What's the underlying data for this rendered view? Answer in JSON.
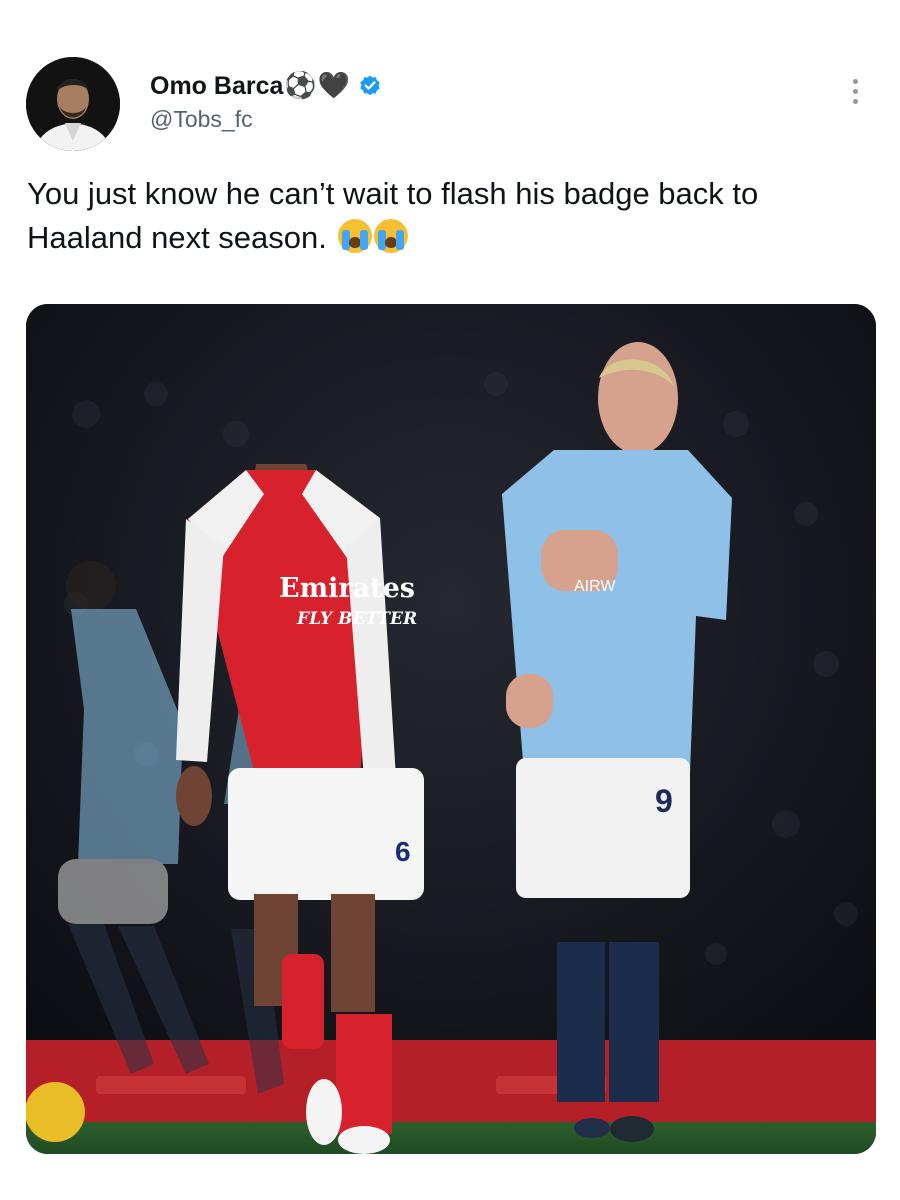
{
  "author": {
    "display_name": "Omo Barca",
    "name_emojis": [
      "⚽",
      "🖤"
    ],
    "verified": true,
    "handle": "@Tobs_fc"
  },
  "tweet": {
    "text": "You just know he can’t wait to flash his badge back to Haaland next season.",
    "trailing_emojis": [
      "😭",
      "😭"
    ]
  },
  "media": {
    "left_shirt": {
      "sponsor": "Emirates",
      "slogan": "FLY BETTER",
      "number": "6"
    },
    "right_shirt": {
      "sponsor_fragment": "AIRW",
      "number": "9"
    }
  },
  "colors": {
    "verified": "#1d9bf0",
    "arsenal_red": "#d7212c",
    "city_blue": "#8fc0e8",
    "text": "#0f1419",
    "muted": "#536471"
  },
  "icons": {
    "verified": "verified-badge-icon",
    "more": "more-vertical-icon",
    "crying": "loudly-crying-face-icon"
  }
}
